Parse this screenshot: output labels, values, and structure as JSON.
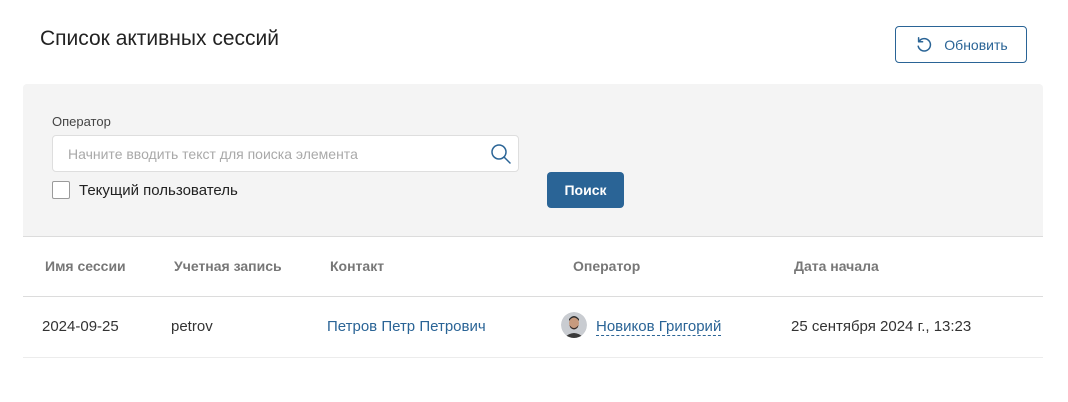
{
  "header": {
    "title": "Список активных сессий",
    "refresh_label": "Обновить",
    "refresh_icon": "refresh-icon"
  },
  "filter": {
    "operator_label": "Оператор",
    "search_placeholder": "Начните вводить текст для поиска элемента",
    "search_value": "",
    "search_icon": "search-icon",
    "current_user_label": "Текущий пользователь",
    "current_user_checked": false,
    "search_button_label": "Поиск"
  },
  "table": {
    "columns": [
      "Имя сессии",
      "Учетная запись",
      "Контакт",
      "Оператор",
      "Дата начала"
    ],
    "rows": [
      {
        "session_name": "2024-09-25",
        "account": "petrov",
        "contact": "Петров Петр Петрович",
        "operator": "Новиков Григорий",
        "start_date": "25 сентября 2024 г., 13:23"
      }
    ]
  },
  "colors": {
    "accent": "#2a6496",
    "panel_bg": "#f4f4f4",
    "header_text": "#777777"
  }
}
